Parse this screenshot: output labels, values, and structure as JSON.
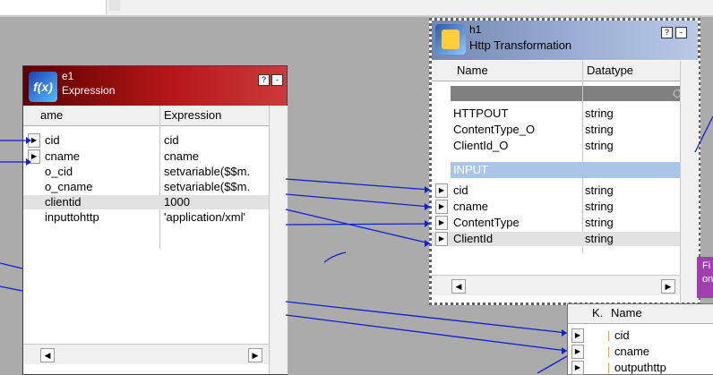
{
  "expression": {
    "name": "e1",
    "type": "Expression",
    "icon": "expression-icon",
    "help_btn": "?",
    "min_btn": "-",
    "headers": {
      "name": "ame",
      "expression": "Expression"
    },
    "rows": [
      {
        "name": "cid",
        "expression": "cid"
      },
      {
        "name": "cname",
        "expression": "cname"
      },
      {
        "name": "o_cid",
        "expression": "setvariable($$m."
      },
      {
        "name": "o_cname",
        "expression": "setvariable($$m."
      },
      {
        "name": "clientid",
        "expression": "1000"
      },
      {
        "name": "inputtohttp",
        "expression": "'application/xml'"
      }
    ]
  },
  "http": {
    "name": "h1",
    "type": "Http Transformation",
    "icon": "http-transformation-icon",
    "help_btn": "?",
    "min_btn": "-",
    "headers": {
      "name": "Name",
      "datatype": "Datatype"
    },
    "sep_char": "C",
    "output_rows": [
      {
        "name": "HTTPOUT",
        "datatype": "string"
      },
      {
        "name": "ContentType_O",
        "datatype": "string"
      },
      {
        "name": "ClientId_O",
        "datatype": "string"
      }
    ],
    "group_label": "INPUT",
    "input_rows": [
      {
        "name": "cid",
        "datatype": "string"
      },
      {
        "name": "cname",
        "datatype": "string"
      },
      {
        "name": "ContentType",
        "datatype": "string"
      },
      {
        "name": "ClientId",
        "datatype": "string"
      }
    ]
  },
  "target": {
    "headers": {
      "key": "K.",
      "name": "Name"
    },
    "rows": [
      {
        "name": "cid"
      },
      {
        "name": "cname"
      },
      {
        "name": "outputhttp"
      }
    ]
  },
  "purple_box": {
    "line1": "Fi",
    "line2": "on"
  },
  "colors": {
    "canvas": "#ababab",
    "link": "#1020d0",
    "expression_title": "#8b0a0a",
    "http_title": "#9db2d6"
  }
}
